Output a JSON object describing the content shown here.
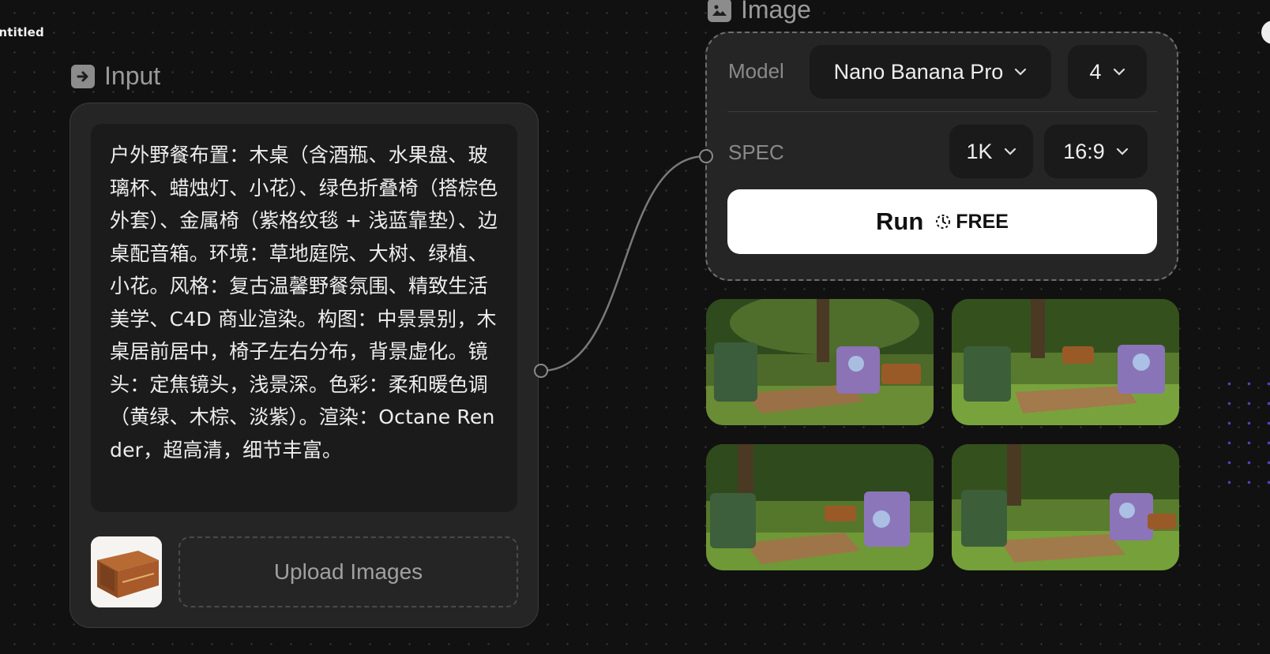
{
  "app": {
    "document_title": "Untitled"
  },
  "input_node": {
    "title": "Input",
    "icon": "arrow-right-box-icon",
    "prompt_text": "户外野餐布置：木桌（含酒瓶、水果盘、玻璃杯、蜡烛灯、小花）、绿色折叠椅（搭棕色外套）、金属椅（紫格纹毯 + 浅蓝靠垫）、边桌配音箱。环境：草地庭院、大树、绿植、小花。风格：复古温馨野餐氛围、精致生活美学、C4D 商业渲染。构图：中景景别，木桌居前居中，椅子左右分布，背景虚化。镜头：定焦镜头，浅景深。色彩：柔和暖色调 （黄绿、木棕、淡紫）。渲染：Octane Render，超高清，细节丰富。",
    "upload_label": "Upload Images",
    "thumbnail": "wooden-speaker-image"
  },
  "image_node": {
    "title": "Image",
    "icon": "image-icon",
    "model_label": "Model",
    "model_value": "Nano Banana Pro",
    "count_value": "4",
    "spec_label": "SPEC",
    "resolution_value": "1K",
    "aspect_value": "16:9",
    "run_label": "Run",
    "run_badge": "FREE",
    "results": [
      "picnic-result-1",
      "picnic-result-2",
      "picnic-result-3",
      "picnic-result-4"
    ]
  },
  "colors": {
    "canvas_bg": "#111111",
    "node_bg": "#252525",
    "run_button_bg": "#ffffff",
    "accent_dots": "#5b46d6"
  }
}
